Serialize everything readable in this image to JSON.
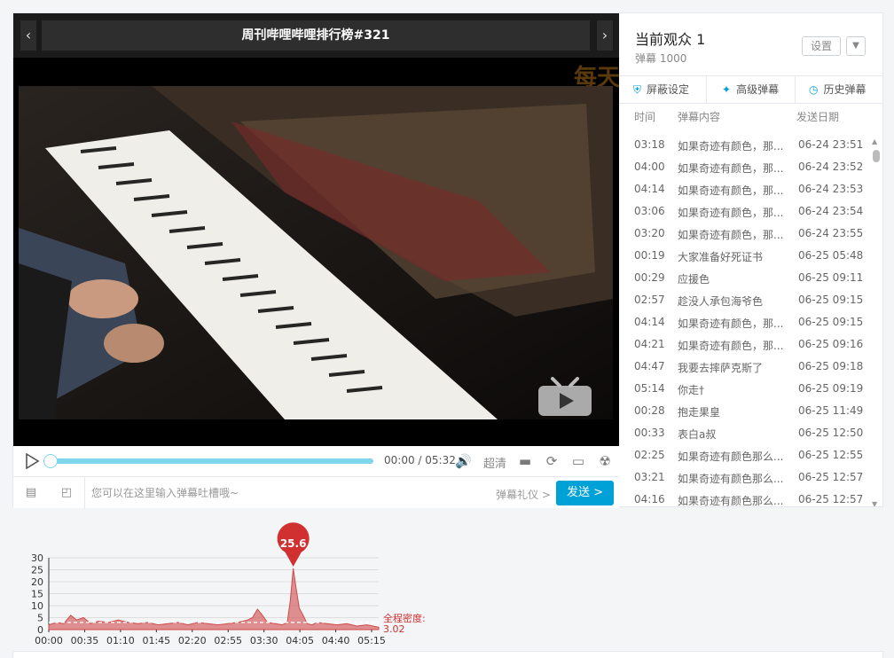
{
  "player": {
    "title": "周刊哔哩哔哩排行榜#321",
    "prev_icon": "‹",
    "next_icon": "›",
    "corner_overlay": "每天",
    "time_display": "00:00 / 05:32",
    "quality": "超清",
    "progress": 0.0,
    "danmaku_placeholder": "您可以在这里输入弹幕吐槽哦~",
    "etiquette": "弹幕礼仪 >",
    "send_label": "发送 >"
  },
  "sidebar": {
    "viewers": "当前观众 1",
    "danmaku_count": "弹幕 1000",
    "settings_label": "设置",
    "tabs": [
      {
        "label": "屏蔽设定",
        "icon": "shield-icon"
      },
      {
        "label": "高级弹幕",
        "icon": "sparkle-icon"
      },
      {
        "label": "历史弹幕",
        "icon": "clock-icon"
      }
    ],
    "columns": {
      "time": "时间",
      "content": "弹幕内容",
      "date": "发送日期"
    },
    "rows": [
      {
        "time": "03:18",
        "text": "如果奇迹有颜色，那...",
        "date": "06-24 23:51"
      },
      {
        "time": "04:00",
        "text": "如果奇迹有颜色，那...",
        "date": "06-24 23:52"
      },
      {
        "time": "04:14",
        "text": "如果奇迹有颜色，那...",
        "date": "06-24 23:53"
      },
      {
        "time": "03:06",
        "text": "如果奇迹有颜色，那...",
        "date": "06-24 23:54"
      },
      {
        "time": "03:20",
        "text": "如果奇迹有颜色，那...",
        "date": "06-24 23:55"
      },
      {
        "time": "00:19",
        "text": "大家准备好死证书",
        "date": "06-25 05:48"
      },
      {
        "time": "00:29",
        "text": "应援色",
        "date": "06-25 09:11"
      },
      {
        "time": "02:57",
        "text": "趁没人承包海爷色",
        "date": "06-25 09:15"
      },
      {
        "time": "04:14",
        "text": "如果奇迹有颜色，那...",
        "date": "06-25 09:15"
      },
      {
        "time": "04:21",
        "text": "如果奇迹有颜色，那...",
        "date": "06-25 09:16"
      },
      {
        "time": "04:47",
        "text": "我要去摔萨克斯了",
        "date": "06-25 09:18"
      },
      {
        "time": "05:14",
        "text": "你走†",
        "date": "06-25 09:19"
      },
      {
        "time": "00:28",
        "text": "抱走果皇",
        "date": "06-25 11:49"
      },
      {
        "time": "00:33",
        "text": "表白a叔",
        "date": "06-25 12:50"
      },
      {
        "time": "02:25",
        "text": "如果奇迹有颜色那么...",
        "date": "06-25 12:55"
      },
      {
        "time": "03:21",
        "text": "如果奇迹有颜色那么...",
        "date": "06-25 12:57"
      },
      {
        "time": "04:16",
        "text": "如果奇迹有颜色那么...",
        "date": "06-25 12:57"
      }
    ]
  },
  "chart_data": {
    "type": "area",
    "x_ticks": [
      "00:00",
      "00:35",
      "01:10",
      "01:45",
      "02:20",
      "02:55",
      "03:30",
      "04:05",
      "04:40",
      "05:15"
    ],
    "y_ticks": [
      0,
      5,
      10,
      15,
      20,
      25,
      30
    ],
    "ylim": [
      0,
      30
    ],
    "x_seconds_max": 332,
    "series": [
      {
        "x": [
          0,
          8,
          15,
          22,
          28,
          35,
          42,
          50,
          60,
          70,
          80,
          90,
          100,
          110,
          120,
          130,
          140,
          150,
          160,
          170,
          180,
          190,
          200,
          205,
          210,
          215,
          220,
          228,
          235,
          240,
          243,
          246,
          249,
          252,
          256,
          260,
          265,
          270,
          280,
          290,
          300,
          310,
          320,
          332
        ],
        "values": [
          2,
          3,
          2.5,
          6,
          4,
          5,
          2.5,
          3.5,
          3,
          4,
          3,
          2.5,
          3,
          2,
          2.5,
          3,
          2,
          3,
          2.5,
          2,
          2.5,
          3,
          4,
          5,
          8.5,
          6,
          3,
          2.5,
          2,
          3,
          12,
          25.6,
          17,
          9,
          6,
          2.5,
          2,
          3,
          2.5,
          2,
          2.5,
          1.5,
          2,
          1
        ]
      }
    ],
    "peak_label": "25.6",
    "average_label": "全程密度:",
    "average_value": "3.02",
    "average": 3.02,
    "fill_color": "#cf4a4a",
    "peak_color": "#d0302f"
  }
}
